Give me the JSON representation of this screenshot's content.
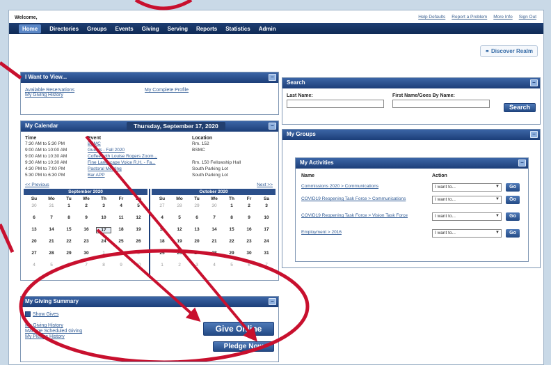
{
  "topbar": {
    "welcome": "Welcome,",
    "links": [
      "Help Defaults",
      "Report a Problem",
      "More Info",
      "Sign Out"
    ]
  },
  "nav": {
    "items": [
      "Home",
      "Directories",
      "Groups",
      "Events",
      "Giving",
      "Serving",
      "Reports",
      "Statistics",
      "Admin"
    ],
    "active": "Home"
  },
  "discover_label": "Discover Realm",
  "want": {
    "title": "I Want to View...",
    "links": [
      "Available Reservations",
      "My Giving History",
      "My Complete Profile"
    ]
  },
  "calendar": {
    "title": "My Calendar",
    "date_title": "Thursday, September 17, 2020",
    "col_time": "Time",
    "col_event": "Event",
    "col_location": "Location",
    "events": [
      {
        "time": "7:30 AM to 5:30 PM",
        "event": "BSMC",
        "location": "Rm. 152"
      },
      {
        "time": "9:00 AM to 10:00 AM",
        "event": "Guests - Fall 2020",
        "location": "BSMC"
      },
      {
        "time": "9:00 AM to 10:30 AM",
        "event": "Coffee with Louise Rogers Zoom...",
        "location": ""
      },
      {
        "time": "9:30 AM to 10:30 AM",
        "event": "Fine Landscape Voice R.H. - Fa...",
        "location": "Rm. 150 Fellowship Hall"
      },
      {
        "time": "4:30 PM to 7:00 PM",
        "event": "Pastoral Meeting",
        "location": "South Parking Lot"
      },
      {
        "time": "5:30 PM to 6:30 PM",
        "event": "Bar APP",
        "location": "South Parking Lot"
      }
    ],
    "prev_label": "<< Previous",
    "next_label": "Next >>",
    "dow": [
      "Su",
      "Mo",
      "Tu",
      "We",
      "Th",
      "Fr",
      "Sa"
    ],
    "months": [
      {
        "name": "September 2020",
        "weeks": [
          [
            "30",
            "31",
            "1",
            "2",
            "3",
            "4",
            "5"
          ],
          [
            "6",
            "7",
            "8",
            "9",
            "10",
            "11",
            "12"
          ],
          [
            "13",
            "14",
            "15",
            "16",
            "17",
            "18",
            "19"
          ],
          [
            "20",
            "21",
            "22",
            "23",
            "24",
            "25",
            "26"
          ],
          [
            "27",
            "28",
            "29",
            "30",
            "1",
            "2",
            "3"
          ],
          [
            "4",
            "5",
            "6",
            "7",
            "8",
            "9",
            "10"
          ]
        ]
      },
      {
        "name": "October 2020",
        "weeks": [
          [
            "27",
            "28",
            "29",
            "30",
            "1",
            "2",
            "3"
          ],
          [
            "4",
            "5",
            "6",
            "7",
            "8",
            "9",
            "10"
          ],
          [
            "11",
            "12",
            "13",
            "14",
            "15",
            "16",
            "17"
          ],
          [
            "18",
            "19",
            "20",
            "21",
            "22",
            "23",
            "24"
          ],
          [
            "25",
            "26",
            "27",
            "28",
            "29",
            "30",
            "31"
          ],
          [
            "1",
            "2",
            "3",
            "4",
            "5",
            "6",
            "7"
          ]
        ]
      }
    ]
  },
  "giving": {
    "title": "My Giving Summary",
    "show_label": "Show Gives",
    "links": [
      "My Giving History",
      "Manage Scheduled Giving",
      "My Pledge History"
    ],
    "give_online": "Give Online",
    "pledge_now": "Pledge Now"
  },
  "search": {
    "title": "Search",
    "last_name_label": "Last Name:",
    "first_name_label": "First Name/Goes By Name:",
    "button": "Search"
  },
  "groups": {
    "title": "My Groups",
    "activities_title": "My Activities",
    "col_name": "Name",
    "col_action": "Action",
    "rows": [
      {
        "name": "Commissions 2020 > Communications",
        "action": "I want to...",
        "go": "Go"
      },
      {
        "name": "COVID19 Reopening Task Force > Communications",
        "action": "I want to...",
        "go": "Go"
      },
      {
        "name": "COVID19 Reopening Task Force > Vision Task Force",
        "action": "I want to...",
        "go": "Go"
      },
      {
        "name": "Employment > 2016",
        "action": "I want to...",
        "go": "Go"
      }
    ]
  },
  "colors": {
    "nav_bg": "#0f2a55",
    "header_blue": "#1c3e78",
    "annotation_red": "#c8102e"
  },
  "icons": [
    "minimize-icon",
    "chevron-down-icon",
    "checkbox-icon",
    "discover-icon"
  ]
}
